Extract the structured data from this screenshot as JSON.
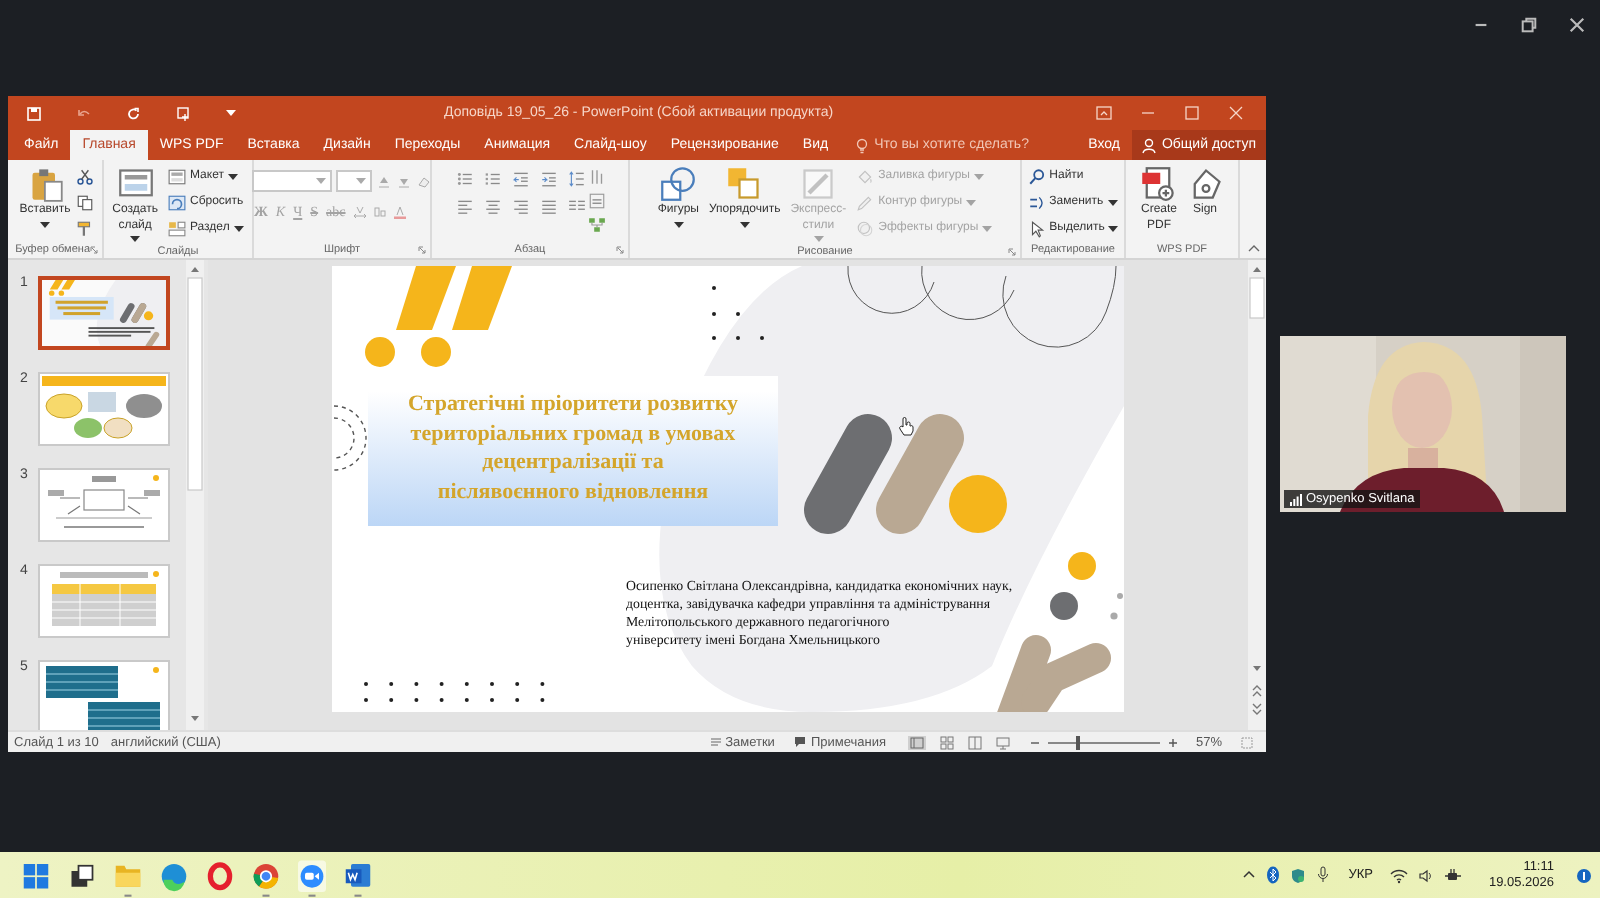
{
  "meeting": {
    "participant_name": "Osypenko Svitlana"
  },
  "powerpoint": {
    "title": "Доповідь 19_05_26  -  PowerPoint (Сбой активации продукта)",
    "tabs": [
      {
        "label": "Файл",
        "selected": false
      },
      {
        "label": "Главная",
        "selected": true
      },
      {
        "label": "WPS PDF",
        "selected": false
      },
      {
        "label": "Вставка",
        "selected": false
      },
      {
        "label": "Дизайн",
        "selected": false
      },
      {
        "label": "Переходы",
        "selected": false
      },
      {
        "label": "Анимация",
        "selected": false
      },
      {
        "label": "Слайд-шоу",
        "selected": false
      },
      {
        "label": "Рецензирование",
        "selected": false
      },
      {
        "label": "Вид",
        "selected": false
      }
    ],
    "tell_me_placeholder": "Что вы хотите сделать?",
    "sign_in": "Вход",
    "share": "Общий доступ",
    "ribbon_groups": [
      {
        "kind": "clipboard",
        "label": "Буфер обмена",
        "items": [
          {
            "kind": "large",
            "label": "Вставить",
            "dropdown": true,
            "disabled": false
          }
        ]
      },
      {
        "kind": "slides",
        "label": "Слайды",
        "items": [
          {
            "kind": "large",
            "label": "Создать слайд",
            "dropdown": true,
            "disabled": false
          },
          {
            "kind": "small",
            "label": "Макет",
            "dropdown": true,
            "disabled": false
          },
          {
            "kind": "small",
            "label": "Сбросить",
            "dropdown": false,
            "disabled": false
          },
          {
            "kind": "small",
            "label": "Раздел",
            "dropdown": true,
            "disabled": false
          }
        ]
      },
      {
        "kind": "font",
        "label": "Шрифт",
        "items": [
          {
            "kind": "format",
            "label": "Ж",
            "disabled": true
          },
          {
            "kind": "format",
            "label": "К",
            "disabled": true
          },
          {
            "kind": "format",
            "label": "Ч",
            "disabled": true
          },
          {
            "kind": "format",
            "label": "S",
            "disabled": true
          },
          {
            "kind": "format",
            "label": "abc",
            "disabled": true
          }
        ]
      },
      {
        "kind": "paragraph",
        "label": "Абзац"
      },
      {
        "kind": "drawing",
        "label": "Рисование",
        "items": [
          {
            "kind": "large",
            "label": "Фигуры",
            "dropdown": true,
            "disabled": false
          },
          {
            "kind": "large",
            "label": "Упорядочить",
            "dropdown": true,
            "disabled": false
          },
          {
            "kind": "large",
            "label": "Экспресс-стили",
            "dropdown": true,
            "disabled": true
          },
          {
            "kind": "small",
            "label": "Заливка фигуры",
            "dropdown": true,
            "disabled": true
          },
          {
            "kind": "small",
            "label": "Контур фигуры",
            "dropdown": true,
            "disabled": true
          },
          {
            "kind": "small",
            "label": "Эффекты фигуры",
            "dropdown": true,
            "disabled": true
          }
        ]
      },
      {
        "kind": "editing",
        "label": "Редактирование",
        "items": [
          {
            "kind": "small",
            "label": "Найти",
            "dropdown": false,
            "disabled": false
          },
          {
            "kind": "small",
            "label": "Заменить",
            "dropdown": true,
            "disabled": false
          },
          {
            "kind": "small",
            "label": "Выделить",
            "dropdown": true,
            "disabled": false
          }
        ]
      },
      {
        "kind": "wps",
        "label": "WPS PDF",
        "items": [
          {
            "kind": "large",
            "label": "Create PDF",
            "dropdown": false,
            "disabled": false
          },
          {
            "kind": "large",
            "label": "Sign",
            "dropdown": false,
            "disabled": false
          }
        ]
      }
    ],
    "thumbnails": [
      {
        "number": "1",
        "selected": true
      },
      {
        "number": "2",
        "selected": false
      },
      {
        "number": "3",
        "selected": false
      },
      {
        "number": "4",
        "selected": false
      },
      {
        "number": "5",
        "selected": false
      }
    ],
    "slide": {
      "title": "Стратегічні пріоритети розвитку\nтериторіальних громад в умовах\nдецентралізації та\nпіслявоєнного відновлення",
      "author": "Осипенко Світлана Олександрівна, кандидатка економічних наук,\nдоцентка, завідувачка кафедри управління та адміністрування\nМелітопольського державного педагогічного\nуніверситету імені Богдана Хмельницького"
    },
    "status_bar": {
      "slide_position": "Слайд 1 из 10",
      "language": "английский (США)",
      "notes": "Заметки",
      "comments": "Примечания",
      "zoom_slider": {
        "level": 0.27
      },
      "zoom": "57%"
    }
  },
  "taskbar": {
    "language": "УКР",
    "time": "11:11",
    "date": "19.05.2026"
  }
}
